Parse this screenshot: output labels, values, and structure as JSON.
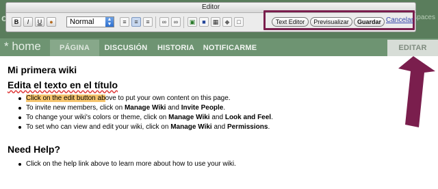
{
  "site": {
    "brand_left": "ot",
    "brand_right": "ikispaces"
  },
  "editor": {
    "title": "Editor",
    "tools": {
      "bold": "B",
      "italic": "I",
      "underline": "U",
      "format_select": "Normal"
    },
    "actions": {
      "text_editor": "Text Editor",
      "preview": "Previsualizar",
      "save": "Guardar",
      "cancel": "Cancelar"
    }
  },
  "nav": {
    "home": "* home",
    "tabs": [
      {
        "label": "PÁGINA"
      },
      {
        "label": "DISCUSIÓN"
      },
      {
        "label": "HISTORIA"
      },
      {
        "label": "NOTIFICARME"
      }
    ],
    "edit": "EDITAR"
  },
  "content": {
    "page_title": "Mi primera wiki",
    "heading": "Edita el texto en el título",
    "items": [
      {
        "highlight": "Click on the edit button ab",
        "rest": "ove to put your own content on this page."
      },
      {
        "pre": "To invite new members, click on ",
        "b1": "Manage Wiki",
        "mid": " and ",
        "b2": "Invite People",
        "post": "."
      },
      {
        "pre": "To change your wiki's colors or theme, click on ",
        "b1": "Manage Wiki",
        "mid": " and ",
        "b2": "Look and Feel",
        "post": "."
      },
      {
        "pre": "To set who can view and edit your wiki, click on ",
        "b1": "Manage Wiki",
        "mid": " and ",
        "b2": "Permissions",
        "post": "."
      }
    ],
    "help_heading": "Need Help?",
    "help_item": "Click on the help link above to learn more about how to use your wiki."
  },
  "colors": {
    "annotation": "#7a1e4d",
    "nav_bg": "#6e9472",
    "highlight": "#f6c56e"
  }
}
